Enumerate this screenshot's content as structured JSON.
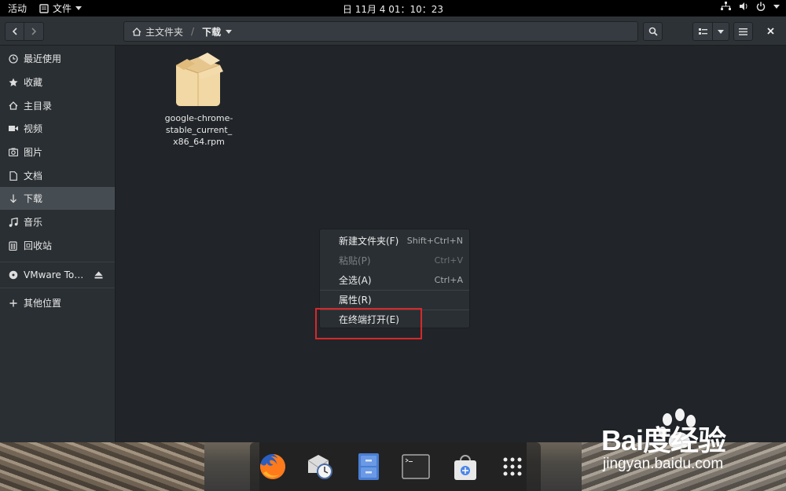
{
  "topbar": {
    "activities": "活动",
    "app_name": "文件",
    "clock": "日 11月 4  01：10：23"
  },
  "header": {
    "path_home": "主文件夹",
    "path_separator": "/",
    "path_current": "下载"
  },
  "sidebar": {
    "items": [
      {
        "label": "最近使用",
        "icon": "clock-icon"
      },
      {
        "label": "收藏",
        "icon": "star-icon"
      },
      {
        "label": "主目录",
        "icon": "home-icon"
      },
      {
        "label": "视频",
        "icon": "video-icon"
      },
      {
        "label": "图片",
        "icon": "camera-icon"
      },
      {
        "label": "文档",
        "icon": "document-icon"
      },
      {
        "label": "下载",
        "icon": "download-icon"
      },
      {
        "label": "音乐",
        "icon": "music-icon"
      },
      {
        "label": "回收站",
        "icon": "trash-icon"
      }
    ],
    "devices": [
      {
        "label": "VMware To…",
        "icon": "disc-icon"
      }
    ],
    "other": {
      "label": "其他位置",
      "icon": "plus-icon"
    }
  },
  "files": [
    {
      "name": "google-chrome-stable_current_x86_64.rpm",
      "lines": [
        "google-chrome-",
        "stable_current_",
        "x86_64.rpm"
      ],
      "icon": "package-icon"
    }
  ],
  "context_menu": {
    "items": [
      {
        "label": "新建文件夹(F)",
        "accel": "Shift+Ctrl+N",
        "enabled": true
      },
      {
        "label": "粘贴(P)",
        "accel": "Ctrl+V",
        "enabled": false
      },
      {
        "label": "全选(A)",
        "accel": "Ctrl+A",
        "enabled": true
      },
      {
        "label": "属性(R)",
        "accel": "",
        "enabled": true
      },
      {
        "label": "在终端打开(E)",
        "accel": "",
        "enabled": true
      }
    ]
  },
  "dock": {
    "apps": [
      "firefox-icon",
      "mail-clock-icon",
      "file-cabinet-icon",
      "terminal-icon",
      "software-store-icon",
      "app-grid-icon"
    ]
  },
  "watermark": {
    "logo": "Bai度经验",
    "url": "jingyan.baidu.com"
  },
  "colors": {
    "highlight_box": "#d8282a",
    "sidebar_active": "#464d52",
    "main_bg": "#212529"
  }
}
